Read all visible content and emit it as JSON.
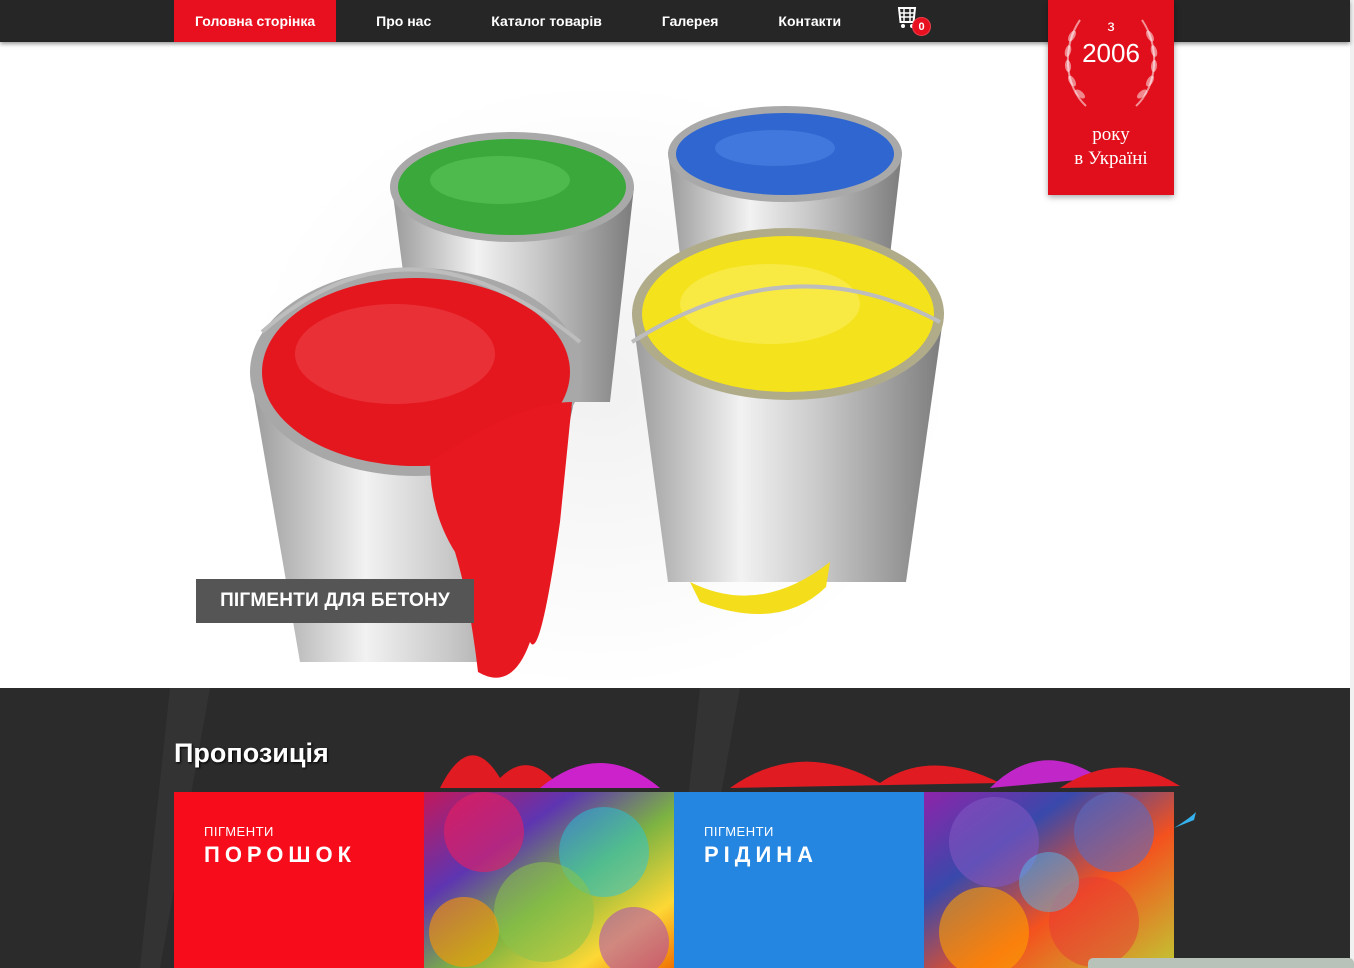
{
  "nav": {
    "items": [
      {
        "label": "Головна сторінка",
        "active": true
      },
      {
        "label": "Про нас"
      },
      {
        "label": "Каталог товарів"
      },
      {
        "label": "Галерея"
      },
      {
        "label": "Контакти"
      }
    ],
    "cart_icon": "basket-icon",
    "cart_count": "0"
  },
  "badge": {
    "prefix": "з",
    "year": "2006",
    "line1": "року",
    "line2": "в Україні",
    "icon": "laurel-wreath-icon"
  },
  "hero": {
    "caption": "ПІГМЕНТИ ДЛЯ БЕТОНУ",
    "image": "paint-buckets-image"
  },
  "offer": {
    "title": "Пропозиція",
    "tiles": [
      {
        "sub": "ПІГМЕНТИ",
        "main": "ПОРОШОК",
        "color": "#f70c1b"
      },
      {
        "image": "colorful-paint-collage"
      },
      {
        "sub": "ПІГМЕНТИ",
        "main": "РІДИНА",
        "color": "#2486e0"
      },
      {
        "image": "colorful-paint-collage-2"
      }
    ]
  },
  "colors": {
    "accent": "#e8101e",
    "topbar": "#262626",
    "section_bg": "#2b2b2b",
    "caption_bg": "#555555"
  }
}
